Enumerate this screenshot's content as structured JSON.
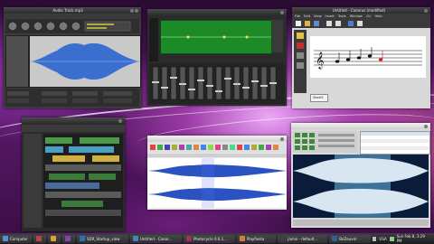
{
  "windows": {
    "audacity_top": {
      "title": "Audio Track.mp3"
    },
    "mixer": {
      "title": ""
    },
    "notation": {
      "title": "Untitled - Canorus (modified)",
      "menu": [
        "File",
        "Edit",
        "View",
        "Insert",
        "Tools",
        "Window",
        "CLI",
        "Help"
      ],
      "sheet_tab": "Sheet1"
    },
    "sequencer": {
      "title": ""
    },
    "wave_editor": {
      "title": ""
    },
    "audio_editor2": {
      "title": ""
    }
  },
  "taskbar": {
    "items": [
      {
        "label": "Computer",
        "color": "#5a8fd6"
      },
      {
        "label": "",
        "color": "#c24040"
      },
      {
        "label": "",
        "color": "#e0a030"
      },
      {
        "label": "",
        "color": "#8844aa"
      },
      {
        "label": "SDR_Startup_view",
        "color": "#2c6fb5"
      },
      {
        "label": "Untitled - Canor...",
        "color": "#4a7fc0"
      },
      {
        "label": "Photocycle 0.6.1...",
        "color": "#a03060"
      },
      {
        "label": "Playfiesta",
        "color": "#d08030"
      },
      {
        "label": "jamin - default...",
        "color": "#404040"
      },
      {
        "label": "BeZeuvrir",
        "color": "#3060a0"
      }
    ],
    "lang": "USA",
    "clock": "Sun Feb 8, 3:29 PM"
  }
}
